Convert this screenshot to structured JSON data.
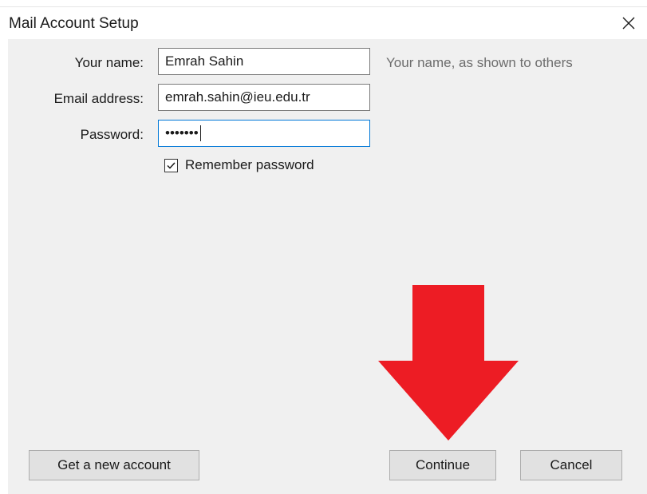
{
  "window": {
    "title": "Mail Account Setup",
    "close_glyph": "✕"
  },
  "form": {
    "name_label": "Your name:",
    "name_value": "Emrah Sahin",
    "name_hint": "Your name, as shown to others",
    "email_label": "Email address:",
    "email_value": "emrah.sahin@ieu.edu.tr",
    "password_label": "Password:",
    "password_value": "•••••••",
    "remember_label": "Remember password",
    "remember_checked": true
  },
  "buttons": {
    "get_new_account": "Get a new account",
    "continue": "Continue",
    "cancel": "Cancel"
  },
  "annotation": {
    "arrow_color": "#ed1c24",
    "arrow_icon": "arrow-down-icon"
  }
}
